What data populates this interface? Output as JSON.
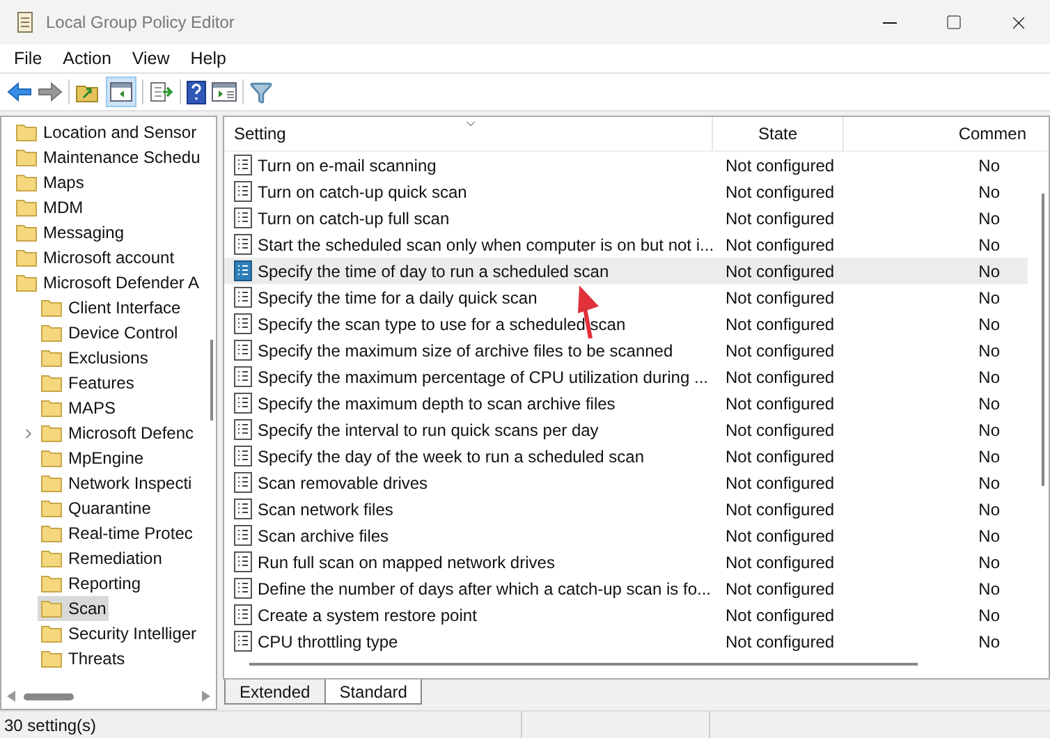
{
  "window": {
    "title": "Local Group Policy Editor"
  },
  "menu": [
    "File",
    "Action",
    "View",
    "Help"
  ],
  "tree": {
    "items": [
      {
        "label": "Location and Sensor",
        "selected": false
      },
      {
        "label": "Maintenance Schedu",
        "selected": false
      },
      {
        "label": "Maps",
        "selected": false
      },
      {
        "label": "MDM",
        "selected": false
      },
      {
        "label": "Messaging",
        "selected": false
      },
      {
        "label": "Microsoft account",
        "selected": false
      },
      {
        "label": "Microsoft Defender A",
        "selected": false,
        "children": [
          {
            "label": "Client Interface",
            "selected": false
          },
          {
            "label": "Device Control",
            "selected": false
          },
          {
            "label": "Exclusions",
            "selected": false
          },
          {
            "label": "Features",
            "selected": false
          },
          {
            "label": "MAPS",
            "selected": false
          },
          {
            "label": "Microsoft Defenc",
            "selected": false,
            "expanded": false
          },
          {
            "label": "MpEngine",
            "selected": false
          },
          {
            "label": "Network Inspecti",
            "selected": false
          },
          {
            "label": "Quarantine",
            "selected": false
          },
          {
            "label": "Real-time Protec",
            "selected": false
          },
          {
            "label": "Remediation",
            "selected": false
          },
          {
            "label": "Reporting",
            "selected": false
          },
          {
            "label": "Scan",
            "selected": true
          },
          {
            "label": "Security Intelliger",
            "selected": false
          },
          {
            "label": "Threats",
            "selected": false
          }
        ]
      }
    ]
  },
  "table": {
    "columns": [
      "Setting",
      "State",
      "Commen"
    ],
    "rows": [
      {
        "setting": "Turn on e-mail scanning",
        "state": "Not configured",
        "comment": "No",
        "selected": false
      },
      {
        "setting": "Turn on catch-up quick scan",
        "state": "Not configured",
        "comment": "No",
        "selected": false
      },
      {
        "setting": "Turn on catch-up full scan",
        "state": "Not configured",
        "comment": "No",
        "selected": false
      },
      {
        "setting": "Start the scheduled scan only when computer is on but not i...",
        "state": "Not configured",
        "comment": "No",
        "selected": false
      },
      {
        "setting": "Specify the time of day to run a scheduled scan",
        "state": "Not configured",
        "comment": "No",
        "selected": true
      },
      {
        "setting": "Specify the time for a daily quick scan",
        "state": "Not configured",
        "comment": "No",
        "selected": false
      },
      {
        "setting": "Specify the scan type to use for a scheduled scan",
        "state": "Not configured",
        "comment": "No",
        "selected": false
      },
      {
        "setting": "Specify the maximum size of archive files to be scanned",
        "state": "Not configured",
        "comment": "No",
        "selected": false
      },
      {
        "setting": "Specify the maximum percentage of CPU utilization during ...",
        "state": "Not configured",
        "comment": "No",
        "selected": false
      },
      {
        "setting": "Specify the maximum depth to scan archive files",
        "state": "Not configured",
        "comment": "No",
        "selected": false
      },
      {
        "setting": "Specify the interval to run quick scans per day",
        "state": "Not configured",
        "comment": "No",
        "selected": false
      },
      {
        "setting": "Specify the day of the week to run a scheduled scan",
        "state": "Not configured",
        "comment": "No",
        "selected": false
      },
      {
        "setting": "Scan removable drives",
        "state": "Not configured",
        "comment": "No",
        "selected": false
      },
      {
        "setting": "Scan network files",
        "state": "Not configured",
        "comment": "No",
        "selected": false
      },
      {
        "setting": "Scan archive files",
        "state": "Not configured",
        "comment": "No",
        "selected": false
      },
      {
        "setting": "Run full scan on mapped network drives",
        "state": "Not configured",
        "comment": "No",
        "selected": false
      },
      {
        "setting": "Define the number of days after which a catch-up scan is fo...",
        "state": "Not configured",
        "comment": "No",
        "selected": false
      },
      {
        "setting": "Create a system restore point",
        "state": "Not configured",
        "comment": "No",
        "selected": false
      },
      {
        "setting": "CPU throttling type",
        "state": "Not configured",
        "comment": "No",
        "selected": false
      }
    ]
  },
  "tabs": [
    {
      "label": "Extended",
      "selected": false
    },
    {
      "label": "Standard",
      "selected": true
    }
  ],
  "status_bar": "30 setting(s)"
}
